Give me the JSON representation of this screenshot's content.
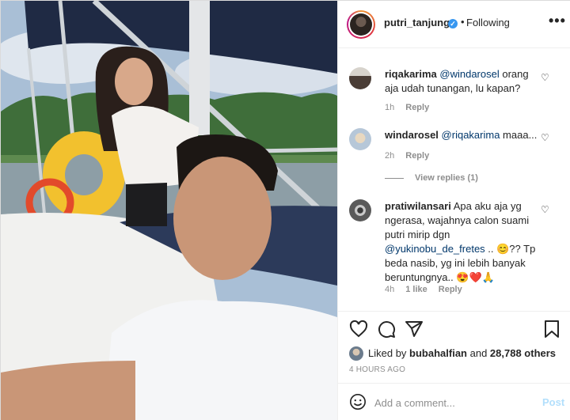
{
  "header": {
    "username": "putri_tanjung",
    "separator": "•",
    "follow_status": "Following",
    "more_label": "•••"
  },
  "comments": [
    {
      "username": "riqakarima",
      "mention": "@windarosel",
      "text": " orang aja udah tunangan, lu kapan?",
      "time": "1h",
      "reply": "Reply"
    },
    {
      "username": "windarosel",
      "mention": "@riqakarima",
      "text": " maaa...",
      "time": "2h",
      "reply": "Reply",
      "view_replies": "View replies (1)"
    },
    {
      "username": "pratiwilansari",
      "text_before": " Apa aku aja yg ngerasa, wajahnya calon suami putri mirip dgn ",
      "mention": "@yukinobu_de_fretes",
      "text_after": " .. 😊?? Tp beda nasib, yg ini lebih banyak beruntungnya.. 😍❤️🙏",
      "time": "4h",
      "likes": "1 like",
      "reply": "Reply"
    }
  ],
  "likes": {
    "prefix": "Liked by ",
    "user": "bubahalfian",
    "middle": " and ",
    "count": "28,788 others"
  },
  "timestamp": "4 HOURS AGO",
  "add_comment": {
    "placeholder": "Add a comment...",
    "post_label": "Post"
  },
  "icons": {
    "heart": "heart-icon",
    "comment": "comment-icon",
    "share": "share-icon",
    "save": "bookmark-icon",
    "emoji": "emoji-icon"
  }
}
